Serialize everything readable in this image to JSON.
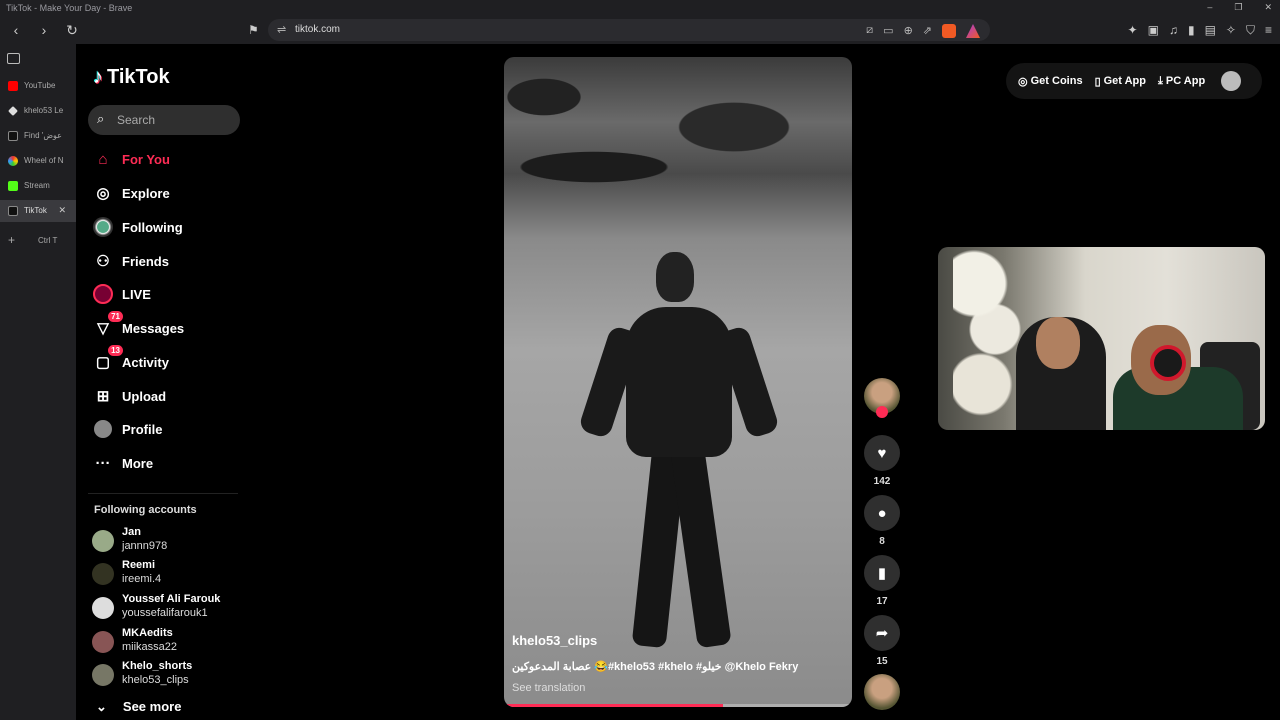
{
  "browser": {
    "window_title": "TikTok - Make Your Day - Brave",
    "url": "tiktok.com",
    "tabs": [
      {
        "label": "YouTube",
        "color": "#ff0000"
      },
      {
        "label": "khelo53 Le",
        "color": "#dddddd"
      },
      {
        "label": "Find 'عوض",
        "color": "#333333"
      },
      {
        "label": "Wheel of N",
        "color": "#e0a020"
      },
      {
        "label": "Stream",
        "color": "#53fc18"
      },
      {
        "label": "TikTok",
        "color": "#111111"
      }
    ],
    "new_tab_label": "Ctrl T"
  },
  "tiktok": {
    "logo": "TikTok",
    "search_placeholder": "Search",
    "nav": [
      {
        "label": "For You",
        "icon": "home-icon",
        "active": true
      },
      {
        "label": "Explore",
        "icon": "compass-icon"
      },
      {
        "label": "Following",
        "icon": "following-avatar-icon"
      },
      {
        "label": "Friends",
        "icon": "friends-icon"
      },
      {
        "label": "LIVE",
        "icon": "live-icon"
      },
      {
        "label": "Messages",
        "icon": "messages-icon",
        "badge": "71"
      },
      {
        "label": "Activity",
        "icon": "activity-icon",
        "badge": "13"
      },
      {
        "label": "Upload",
        "icon": "upload-icon"
      },
      {
        "label": "Profile",
        "icon": "profile-icon"
      },
      {
        "label": "More",
        "icon": "more-icon"
      }
    ],
    "following_title": "Following accounts",
    "accounts": [
      {
        "name": "Jan",
        "handle": "jannn978"
      },
      {
        "name": "Reemi",
        "handle": "ireemi.4"
      },
      {
        "name": "Youssef Ali Farouk",
        "handle": "youssefalifarouk1"
      },
      {
        "name": "MKAedits",
        "handle": "miikassa22"
      },
      {
        "name": "Khelo_shorts",
        "handle": "khelo53_clips"
      }
    ],
    "see_more": "See more"
  },
  "video": {
    "username": "khelo53_clips",
    "description": "عصابة المدعوكين 😂#khelo53 #khelo #خيلو @Khelo Fekry",
    "see_translation": "See translation",
    "progress": 0.63
  },
  "actions": {
    "likes": "142",
    "comments": "8",
    "saves": "17",
    "shares": "15"
  },
  "topbar": {
    "get_coins": "Get Coins",
    "get_app": "Get App",
    "pc_app": "PC App"
  },
  "colors": {
    "accent": "#fe2c55",
    "background": "#000000"
  }
}
